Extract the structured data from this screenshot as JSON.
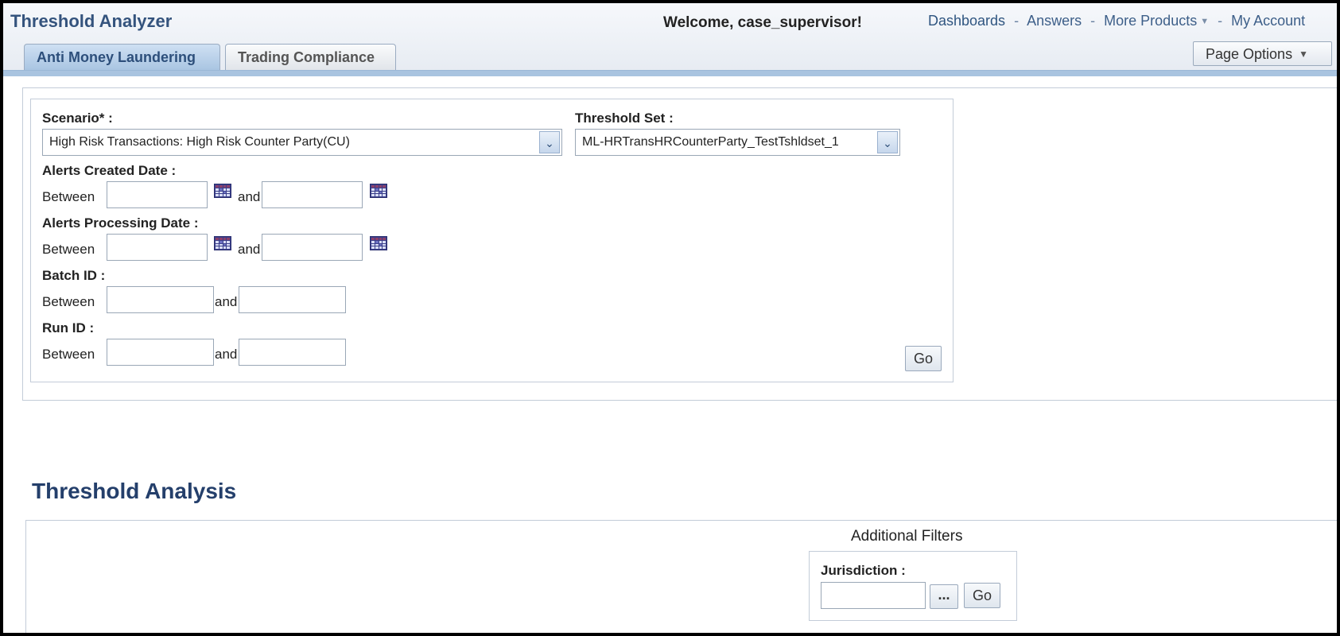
{
  "app": {
    "title": "Threshold Analyzer"
  },
  "header": {
    "welcome": "Welcome, case_supervisor!",
    "nav": {
      "dashboards": "Dashboards",
      "answers": "Answers",
      "more_products": "More Products",
      "my_account": "My Account",
      "separator": "-"
    },
    "page_options": "Page Options"
  },
  "tabs": [
    {
      "label": "Anti Money Laundering",
      "active": true
    },
    {
      "label": "Trading Compliance",
      "active": false
    }
  ],
  "filters": {
    "scenario": {
      "label": "Scenario* :",
      "value": "High Risk Transactions: High Risk Counter Party(CU)"
    },
    "threshold_set": {
      "label": "Threshold Set :",
      "value": "ML-HRTransHRCounterParty_TestTshldset_1"
    },
    "alerts_created": {
      "label": "Alerts Created Date :",
      "between": "Between",
      "and": "and",
      "from": "",
      "to": ""
    },
    "alerts_processing": {
      "label": "Alerts Processing Date :",
      "between": "Between",
      "and": "and",
      "from": "",
      "to": ""
    },
    "batch_id": {
      "label": "Batch ID :",
      "between": "Between",
      "and": "and",
      "from": "",
      "to": ""
    },
    "run_id": {
      "label": "Run ID :",
      "between": "Between",
      "and": "and",
      "from": "",
      "to": ""
    },
    "go": "Go"
  },
  "analysis": {
    "title": "Threshold Analysis",
    "additional_filters": "Additional Filters",
    "jurisdiction": {
      "label": "Jurisdiction :",
      "value": "",
      "browse": "...",
      "go": "Go"
    }
  },
  "icons": {
    "calendar": "calendar-icon",
    "dropdown": "chevron-down-icon"
  },
  "colors": {
    "title_blue": "#34537d",
    "tab_active": "#a9c5e2",
    "bar_blue": "#a9c4e0"
  }
}
